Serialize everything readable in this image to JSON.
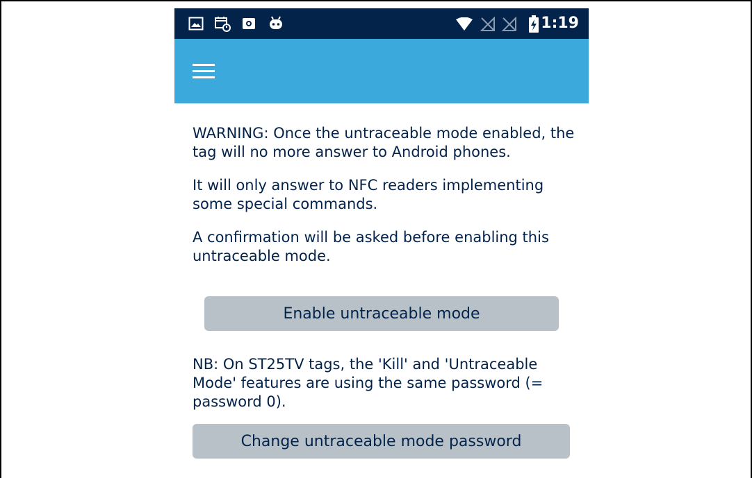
{
  "status_bar": {
    "time": "1:19",
    "icons": [
      "image-icon",
      "calendar-sync-icon",
      "camera-icon",
      "android-icon",
      "wifi-icon",
      "no-signal-icon",
      "no-signal-icon",
      "battery-charging-icon"
    ]
  },
  "app_bar": {
    "menu_icon": "hamburger-menu-icon",
    "color": "#3ca9dc"
  },
  "content": {
    "paragraphs": [
      "WARNING: Once the untraceable mode enabled, the tag will no more answer to Android phones.",
      "It will only answer to NFC readers implementing some special commands.",
      "A confirmation will be asked before enabling this untraceable mode."
    ],
    "enable_button": "Enable untraceable mode",
    "note": "NB: On ST25TV tags, the 'Kill' and 'Untraceable Mode' features are using the same password (= password 0).",
    "change_password_button": "Change untraceable mode password"
  },
  "colors": {
    "status_bar": "#03234b",
    "text": "#03234b",
    "button": "#b8c1c8"
  }
}
